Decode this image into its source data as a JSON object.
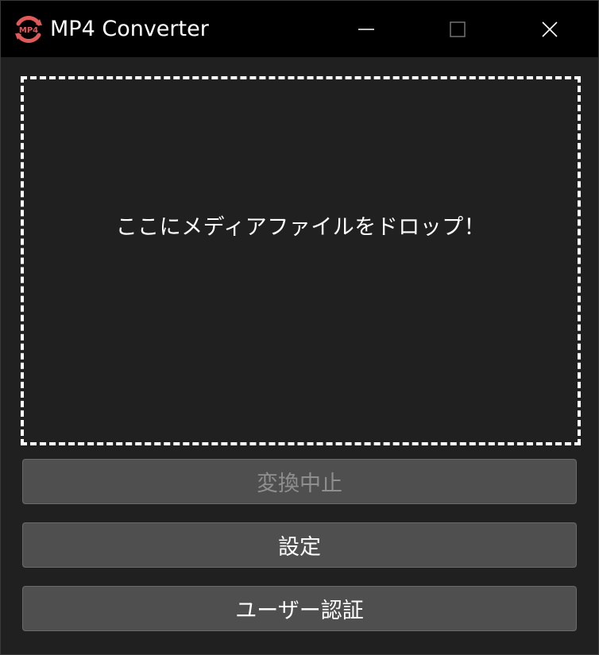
{
  "window": {
    "title": "MP4 Converter",
    "icon_label": "MP4",
    "accent_color": "#e05a5a"
  },
  "titlebar": {
    "minimize_icon": "minimize-icon",
    "maximize_icon": "maximize-icon",
    "close_icon": "close-icon"
  },
  "drop_zone": {
    "text": "ここにメディアファイルをドロップ！"
  },
  "buttons": {
    "stop_label": "変換中止",
    "stop_enabled": false,
    "settings_label": "設定",
    "auth_label": "ユーザー認証"
  }
}
